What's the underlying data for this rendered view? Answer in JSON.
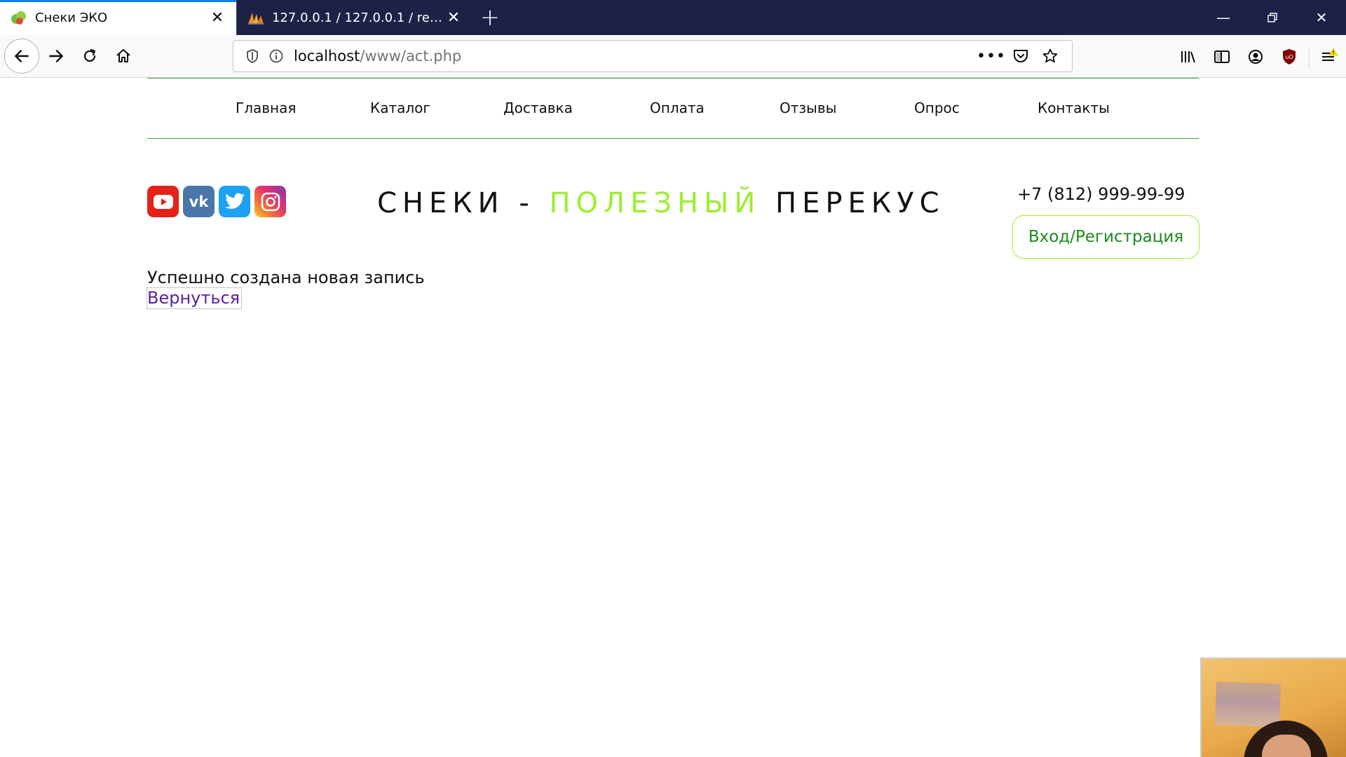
{
  "browser": {
    "tabs": [
      {
        "title": "Снеки ЭКО",
        "active": true,
        "favicon": "leaf-favicon-icon"
      },
      {
        "title": "127.0.0.1 / 127.0.0.1 / register_f",
        "active": false,
        "favicon": "phpmyadmin-favicon-icon"
      }
    ],
    "url": {
      "host": "localhost",
      "path": "/www/act.php"
    }
  },
  "site": {
    "menu": [
      "Главная",
      "Каталог",
      "Доставка",
      "Оплата",
      "Отзывы",
      "Опрос",
      "Контакты"
    ],
    "brand": {
      "part1": "СНЕКИ - ",
      "highlight": "ПОЛЕЗНЫЙ",
      "part2": " ПЕРЕКУС"
    },
    "phone": "+7 (812) 999-99-99",
    "login_label": "Вход/Регистрация",
    "message": "Успешно создана новая запись",
    "back_link": "Вернуться",
    "social": [
      "youtube-icon",
      "vk-icon",
      "twitter-icon",
      "instagram-icon"
    ],
    "vk_text": "vk"
  },
  "colors": {
    "accent": "#9bef2e",
    "menu_border": "#3aa03a",
    "link": "#5b1fa0",
    "tabbar": "#1e2146"
  }
}
